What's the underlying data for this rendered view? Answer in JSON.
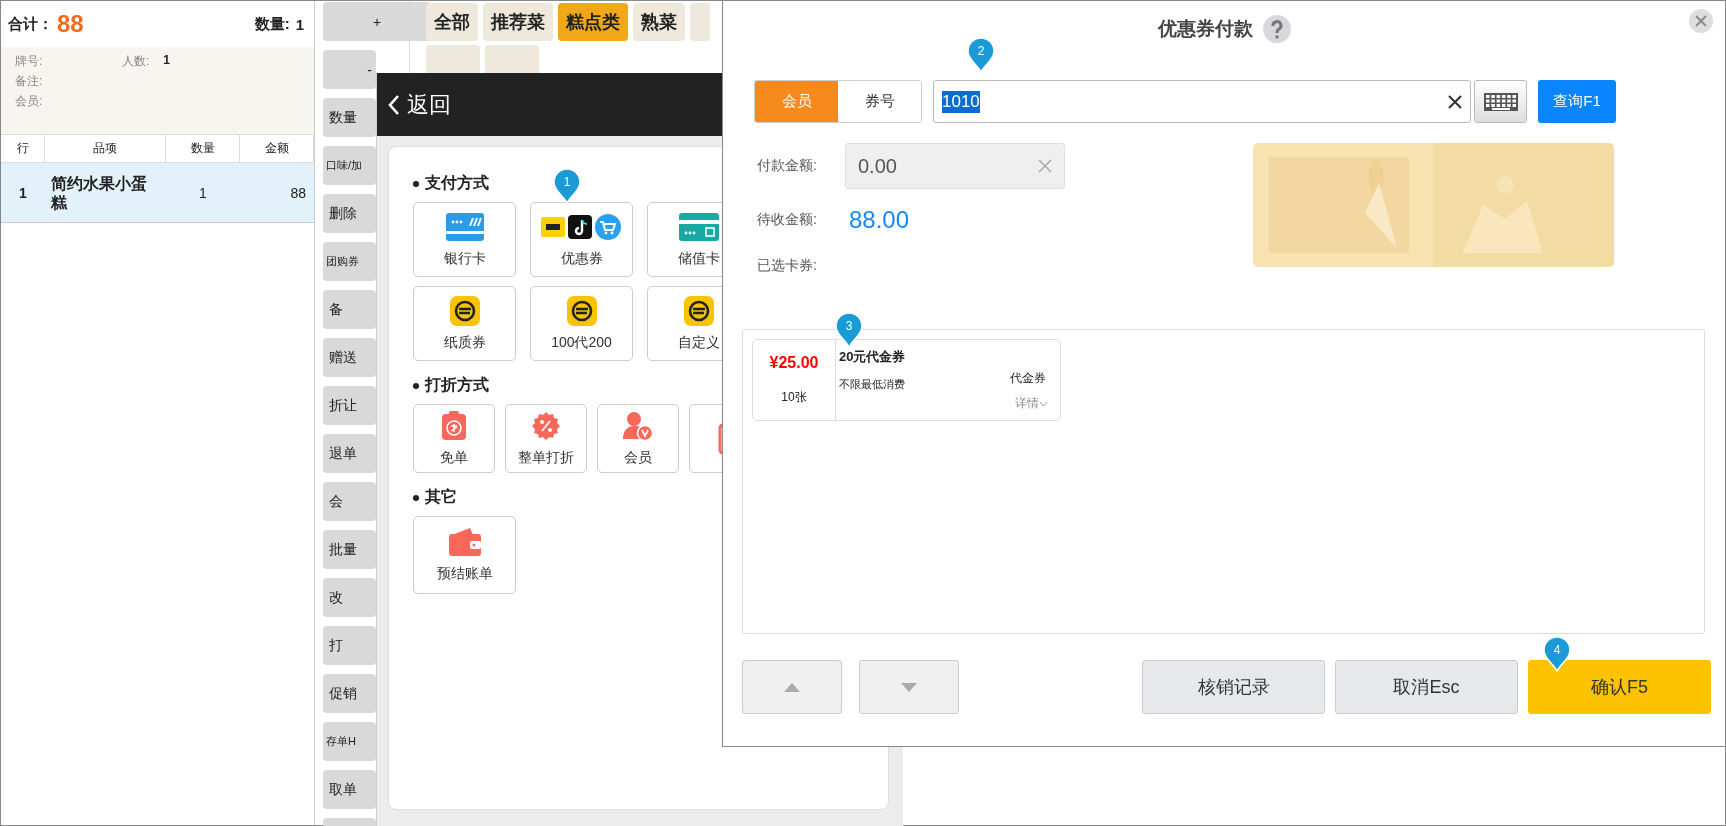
{
  "order": {
    "total_label": "合计：",
    "total": "88",
    "qty_label": "数量:",
    "qty": "1",
    "info": {
      "plate_label": "牌号:",
      "guests_label": "人数:",
      "guests": "1",
      "note_label": "备注:",
      "member_label": "会员:"
    },
    "table": {
      "columns": [
        "行",
        "品项",
        "数量",
        "金额"
      ],
      "rows": [
        {
          "cells": [
            "1",
            "简约水果小蛋糕",
            "1",
            "88"
          ],
          "selected": true
        }
      ]
    }
  },
  "function_buttons": [
    {
      "label": "+",
      "kind": "center"
    },
    {
      "label": "-",
      "kind": "right"
    },
    {
      "label": "数量",
      "kind": "left"
    },
    {
      "label": "口味/加",
      "kind": "small"
    },
    {
      "label": "删除",
      "kind": "left"
    },
    {
      "label": "团购券",
      "kind": "small"
    },
    {
      "label": "备",
      "kind": "left"
    },
    {
      "label": "赠送",
      "kind": "left"
    },
    {
      "label": "折让",
      "kind": "left"
    },
    {
      "label": "退单",
      "kind": "left"
    },
    {
      "label": "会",
      "kind": "left"
    },
    {
      "label": "批量",
      "kind": "left"
    },
    {
      "label": "改",
      "kind": "left"
    },
    {
      "label": "打",
      "kind": "left"
    },
    {
      "label": "促销",
      "kind": "left"
    },
    {
      "label": "存单H",
      "kind": "small"
    },
    {
      "label": "取单",
      "kind": "left"
    },
    {
      "kind": "blank"
    }
  ],
  "category_rows": [
    [
      {
        "label": "全部",
        "selected": false
      },
      {
        "label": "推荐菜",
        "selected": false
      },
      {
        "label": "糕点类",
        "selected": true
      },
      {
        "label": "熟菜",
        "selected": false
      },
      {
        "selected": false
      }
    ],
    [
      {
        "selected": false
      },
      {
        "selected": false
      }
    ]
  ],
  "payment_panel": {
    "back": "返回",
    "sections": [
      {
        "title": "支付方式",
        "kind": "wide",
        "tiles": [
          {
            "label": "银行卡",
            "kind": "bank-card"
          },
          {
            "label": "优惠券",
            "kind": "brands"
          },
          {
            "label": "储值卡",
            "kind": "stored-card"
          },
          {
            "label": "纸质券",
            "kind": "coin"
          },
          {
            "label": "100代200",
            "kind": "coin"
          },
          {
            "label": "自定义",
            "kind": "coin"
          }
        ]
      },
      {
        "title": "打折方式",
        "kind": "narrow",
        "tiles": [
          {
            "label": "免单",
            "kind": "free"
          },
          {
            "label": "整单打折",
            "kind": "discount"
          },
          {
            "label": "会员",
            "kind": "member"
          },
          {
            "kind": "stub"
          }
        ]
      },
      {
        "title": "其它",
        "kind": "wide",
        "tiles": [
          {
            "label": "预结账单",
            "kind": "wallet"
          }
        ]
      }
    ]
  },
  "coupon_dialog": {
    "title": "优惠券付款",
    "modes": [
      {
        "label": "会员",
        "selected": true
      },
      {
        "label": "券号",
        "selected": false
      }
    ],
    "search": {
      "value": "1010",
      "text_selected": true
    },
    "query_button": "查询F1",
    "fields": [
      {
        "label": "付款金额:",
        "kind": "input",
        "value": "0.00"
      },
      {
        "label": "待收金额:",
        "kind": "amount",
        "value": "88.00"
      },
      {
        "label": "已选卡券:",
        "kind": "empty"
      }
    ],
    "coupons": [
      {
        "price": "¥25.00",
        "count": "10张",
        "name": "20元代金券",
        "condition": "不限最低消费",
        "type": "代金券",
        "details": "详情"
      }
    ],
    "buttons": [
      {
        "label": "核销记录",
        "kind": "secondary"
      },
      {
        "label": "取消Esc",
        "kind": "secondary"
      },
      {
        "label": "确认F5",
        "kind": "primary"
      }
    ]
  },
  "pins": [
    {
      "label": "1"
    },
    {
      "label": "2"
    },
    {
      "label": "3"
    },
    {
      "label": "4"
    }
  ]
}
